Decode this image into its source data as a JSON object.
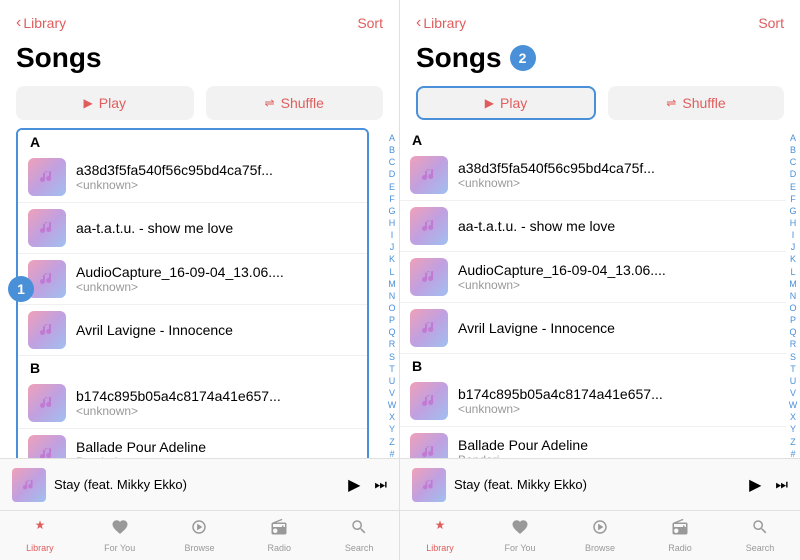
{
  "panels": [
    {
      "id": "panel1",
      "header": {
        "back_label": "Library",
        "sort_label": "Sort"
      },
      "title": "Songs",
      "badge": null,
      "annotation": "1",
      "show_list_outline": true,
      "play_highlighted": false,
      "actions": [
        {
          "id": "play",
          "label": "Play",
          "icon": "▶"
        },
        {
          "id": "shuffle",
          "label": "Shuffle",
          "icon": "⇌"
        }
      ],
      "sections": [
        {
          "letter": "A",
          "songs": [
            {
              "title": "a38d3f5fa540f56c95bd4ca75f...",
              "artist": "<unknown>"
            },
            {
              "title": "aa-t.a.t.u. - show me love",
              "artist": ""
            },
            {
              "title": "AudioCapture_16-09-04_13.06....",
              "artist": "<unknown>"
            },
            {
              "title": "Avril Lavigne - Innocence",
              "artist": ""
            }
          ]
        },
        {
          "letter": "B",
          "songs": [
            {
              "title": "b174c895b05a4c8174a41e657...",
              "artist": "<unknown>"
            },
            {
              "title": "Ballade Pour Adeline",
              "artist": "Bandari"
            }
          ]
        }
      ],
      "now_playing": {
        "title": "Stay (feat. Mikky Ekko)"
      },
      "alpha": [
        "A",
        "B",
        "C",
        "D",
        "E",
        "F",
        "G",
        "H",
        "I",
        "J",
        "K",
        "L",
        "M",
        "N",
        "O",
        "P",
        "Q",
        "R",
        "S",
        "T",
        "U",
        "V",
        "W",
        "X",
        "Y",
        "Z",
        "#"
      ],
      "tabs": [
        {
          "id": "library",
          "label": "Library",
          "icon": "♫",
          "active": true
        },
        {
          "id": "for-you",
          "label": "For You",
          "icon": "♡",
          "active": false
        },
        {
          "id": "browse",
          "label": "Browse",
          "icon": "♩",
          "active": false
        },
        {
          "id": "radio",
          "label": "Radio",
          "icon": "((·))",
          "active": false
        },
        {
          "id": "search",
          "label": "Search",
          "icon": "⌕",
          "active": false
        }
      ]
    },
    {
      "id": "panel2",
      "header": {
        "back_label": "Library",
        "sort_label": "Sort"
      },
      "title": "Songs",
      "badge": "2",
      "annotation": null,
      "show_list_outline": false,
      "play_highlighted": true,
      "actions": [
        {
          "id": "play",
          "label": "Play",
          "icon": "▶"
        },
        {
          "id": "shuffle",
          "label": "Shuffle",
          "icon": "⇌"
        }
      ],
      "sections": [
        {
          "letter": "A",
          "songs": [
            {
              "title": "a38d3f5fa540f56c95bd4ca75f...",
              "artist": "<unknown>"
            },
            {
              "title": "aa-t.a.t.u. - show me love",
              "artist": ""
            },
            {
              "title": "AudioCapture_16-09-04_13.06....",
              "artist": "<unknown>"
            },
            {
              "title": "Avril Lavigne - Innocence",
              "artist": ""
            }
          ]
        },
        {
          "letter": "B",
          "songs": [
            {
              "title": "b174c895b05a4c8174a41e657...",
              "artist": "<unknown>"
            },
            {
              "title": "Ballade Pour Adeline",
              "artist": "Bandari"
            }
          ]
        }
      ],
      "now_playing": {
        "title": "Stay (feat. Mikky Ekko)"
      },
      "alpha": [
        "A",
        "B",
        "C",
        "D",
        "E",
        "F",
        "G",
        "H",
        "I",
        "J",
        "K",
        "L",
        "M",
        "N",
        "O",
        "P",
        "Q",
        "R",
        "S",
        "T",
        "U",
        "V",
        "W",
        "X",
        "Y",
        "Z",
        "#"
      ],
      "tabs": [
        {
          "id": "library",
          "label": "Library",
          "icon": "♫",
          "active": true
        },
        {
          "id": "for-you",
          "label": "For You",
          "icon": "♡",
          "active": false
        },
        {
          "id": "browse",
          "label": "Browse",
          "icon": "♩",
          "active": false
        },
        {
          "id": "radio",
          "label": "Radio",
          "icon": "((·))",
          "active": false
        },
        {
          "id": "search",
          "label": "Search",
          "icon": "⌕",
          "active": false
        }
      ]
    }
  ]
}
